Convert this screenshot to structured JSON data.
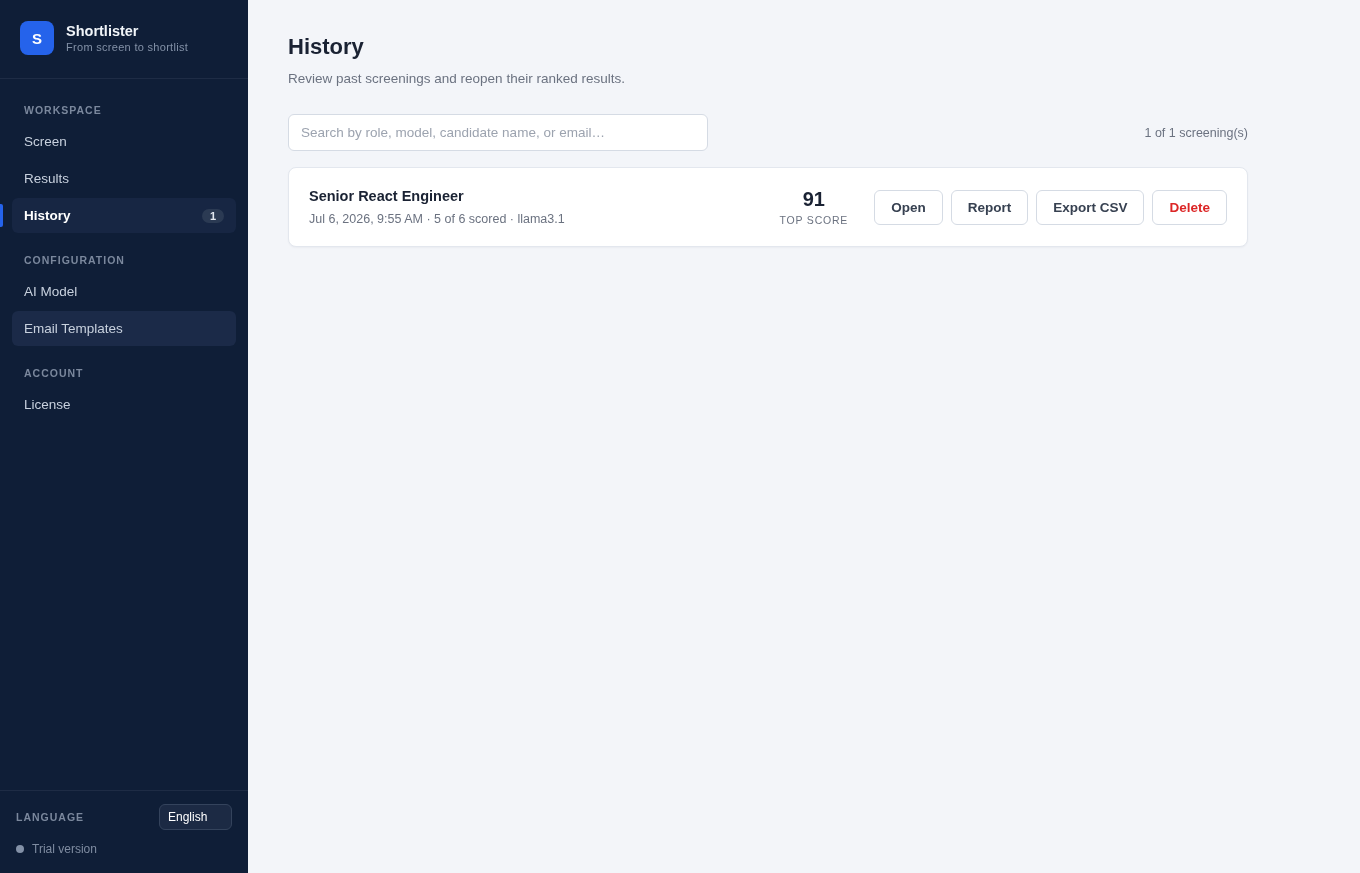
{
  "sidebar": {
    "brand": {
      "logo_letter": "S",
      "name": "Shortlister",
      "tagline": "From screen to shortlist"
    },
    "sections": [
      {
        "title": "WORKSPACE",
        "items": [
          {
            "label": "Screen",
            "selected": false,
            "hovered": false
          },
          {
            "label": "Results",
            "selected": false,
            "hovered": false
          },
          {
            "label": "History",
            "selected": true,
            "hovered": false,
            "badge": "1"
          }
        ]
      },
      {
        "title": "CONFIGURATION",
        "items": [
          {
            "label": "AI Model",
            "selected": false,
            "hovered": false
          },
          {
            "label": "Email Templates",
            "selected": false,
            "hovered": true
          }
        ]
      },
      {
        "title": "ACCOUNT",
        "items": [
          {
            "label": "License",
            "selected": false,
            "hovered": false
          }
        ]
      }
    ],
    "footer": {
      "language_label": "LANGUAGE",
      "language": {
        "value": "English"
      },
      "license_status": "Trial version"
    }
  },
  "main": {
    "title": "History",
    "subtitle": "Review past screenings and reopen their ranked results.",
    "search": {
      "placeholder": "Search by role, model, candidate name, or email…"
    },
    "count": "1 of 1 screening(s)",
    "screenings": [
      {
        "role": "Senior React Engineer",
        "meta": "Jul 6, 2026, 9:55 AM · 5 of 6 scored · llama3.1",
        "score": "91",
        "score_label": "TOP SCORE",
        "actions": [
          {
            "label": "Open",
            "kind": "default"
          },
          {
            "label": "Report",
            "kind": "default"
          },
          {
            "label": "Export CSV",
            "kind": "default"
          },
          {
            "label": "Delete",
            "kind": "danger"
          }
        ]
      }
    ]
  }
}
